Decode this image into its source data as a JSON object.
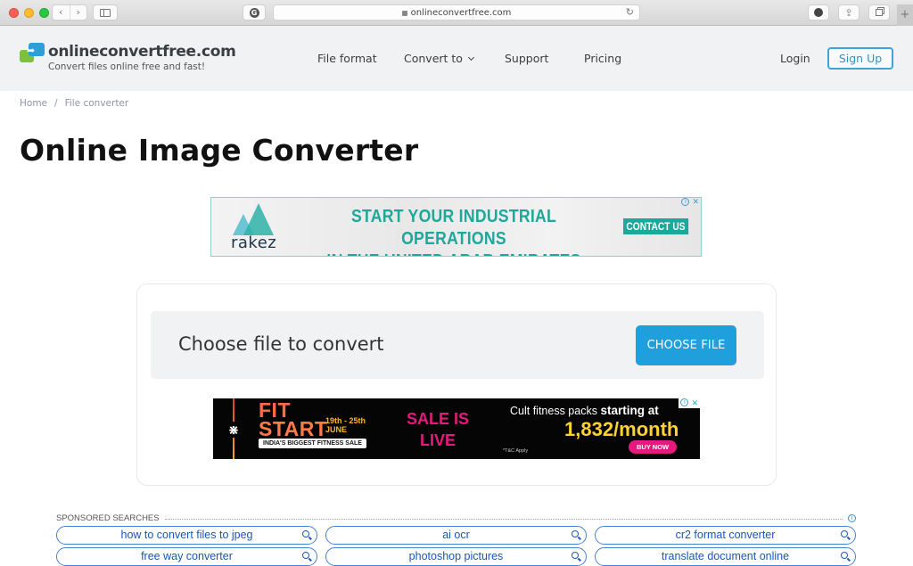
{
  "browser": {
    "url": "onlineconvertfree.com",
    "nav_back": "‹",
    "nav_forward": "›",
    "extension_label": "G",
    "reload": "↻",
    "new_tab": "+",
    "share": "⇪"
  },
  "header": {
    "brand_name": "onlineconvertfree.com",
    "tagline": "Convert files online free and fast!",
    "nav": [
      {
        "label": "File format"
      },
      {
        "label": "Convert to",
        "has_dropdown": true
      },
      {
        "label": "Support"
      },
      {
        "label": "Pricing"
      }
    ],
    "login": "Login",
    "signup": "Sign Up",
    "colors": {
      "accent": "#2a97d0",
      "header_bg": "#f1f2f4"
    }
  },
  "breadcrumb": {
    "items": [
      "Home",
      "File converter"
    ],
    "separator": "/"
  },
  "page_title": "Online Image Converter",
  "ad_top": {
    "brand": "rakez",
    "headline_line1": "START YOUR INDUSTRIAL OPERATIONS",
    "headline_line2": "IN THE UNITED ARAB EMIRATES",
    "cta": "CONTACT US",
    "adchoices": "i",
    "close": "✕"
  },
  "converter": {
    "prompt": "Choose file to convert",
    "button": "CHOOSE FILE",
    "button_color": "#1f9fdc"
  },
  "ad_bottom": {
    "logo_glyph": "⋇",
    "fit": "FIT",
    "start": "START",
    "dates_line1": "19th - 25th",
    "dates_line2": "JUNE",
    "tag": "INDIA'S BIGGEST FITNESS SALE",
    "sale_line1": "SALE IS",
    "sale_line2": "LIVE",
    "packs_text": "Cult fitness packs ",
    "packs_bold": "starting at",
    "price": "1,832/month",
    "tnc": "*T&C Apply",
    "buy": "BUY NOW",
    "adchoices": "i",
    "close": "✕"
  },
  "sponsored": {
    "heading": "SPONSORED SEARCHES",
    "info": "i",
    "items": [
      "how to convert files to jpeg",
      "ai ocr",
      "cr2 format converter",
      "free way converter",
      "photoshop pictures",
      "translate document online"
    ]
  }
}
